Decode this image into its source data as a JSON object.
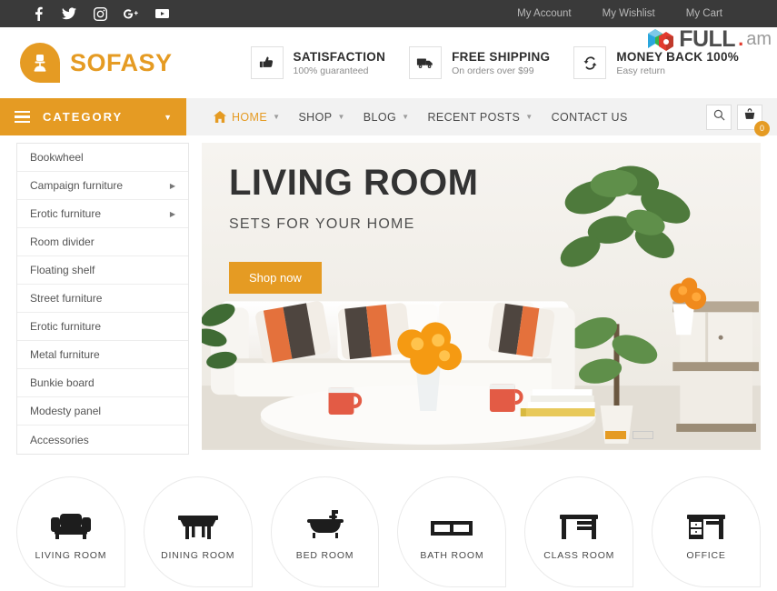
{
  "topbar": {
    "social": [
      {
        "name": "facebook-icon",
        "label": "Facebook"
      },
      {
        "name": "twitter-icon",
        "label": "Twitter"
      },
      {
        "name": "instagram-icon",
        "label": "Instagram"
      },
      {
        "name": "google-plus-icon",
        "label": "Google Plus"
      },
      {
        "name": "youtube-icon",
        "label": "YouTube"
      }
    ],
    "links": [
      "My Account",
      "My Wishlist",
      "My Cart"
    ]
  },
  "watermark": {
    "name": "FULL",
    "dot": ".",
    "tld": "am"
  },
  "header": {
    "logo": "SOFASY",
    "services": [
      {
        "icon": "thumbs-up-icon",
        "title": "SATISFACTION",
        "sub": "100% guaranteed"
      },
      {
        "icon": "truck-icon",
        "title": "FREE SHIPPING",
        "sub": "On orders over $99"
      },
      {
        "icon": "refresh-icon",
        "title": "MONEY BACK 100%",
        "sub": "Easy return"
      }
    ]
  },
  "nav": {
    "category_label": "CATEGORY",
    "items": [
      {
        "label": "HOME",
        "active": true,
        "caret": true,
        "home_icon": true
      },
      {
        "label": "SHOP",
        "active": false,
        "caret": true,
        "home_icon": false
      },
      {
        "label": "BLOG",
        "active": false,
        "caret": true,
        "home_icon": false
      },
      {
        "label": "RECENT POSTS",
        "active": false,
        "caret": true,
        "home_icon": false
      },
      {
        "label": "CONTACT US",
        "active": false,
        "caret": false,
        "home_icon": false
      }
    ],
    "cart_count": "0"
  },
  "sidebar": {
    "items": [
      {
        "label": "Bookwheel",
        "submenu": false
      },
      {
        "label": "Campaign furniture",
        "submenu": true
      },
      {
        "label": "Erotic furniture",
        "submenu": true
      },
      {
        "label": "Room divider",
        "submenu": false
      },
      {
        "label": "Floating shelf",
        "submenu": false
      },
      {
        "label": "Street furniture",
        "submenu": false
      },
      {
        "label": "Erotic furniture",
        "submenu": false
      },
      {
        "label": "Metal furniture",
        "submenu": false
      },
      {
        "label": "Bunkie board",
        "submenu": false
      },
      {
        "label": "Modesty panel",
        "submenu": false
      },
      {
        "label": "Accessories",
        "submenu": false
      }
    ]
  },
  "hero": {
    "title": "LIVING ROOM",
    "subtitle": "SETS FOR YOUR HOME",
    "button": "Shop now",
    "slides": [
      {
        "active": true
      },
      {
        "active": false
      }
    ]
  },
  "categories": [
    {
      "label": "LIVING ROOM",
      "icon": "sofa-icon"
    },
    {
      "label": "DINING ROOM",
      "icon": "dining-table-icon"
    },
    {
      "label": "BED ROOM",
      "icon": "bathtub-icon"
    },
    {
      "label": "BATH ROOM",
      "icon": "bench-icon"
    },
    {
      "label": "CLASS ROOM",
      "icon": "school-desk-icon"
    },
    {
      "label": "OFFICE",
      "icon": "office-desk-icon"
    }
  ],
  "colors": {
    "accent": "#e59b23",
    "topbar_bg": "#3a3a3a",
    "nav_bg": "#f2f2f2",
    "text_dark": "#333333"
  }
}
